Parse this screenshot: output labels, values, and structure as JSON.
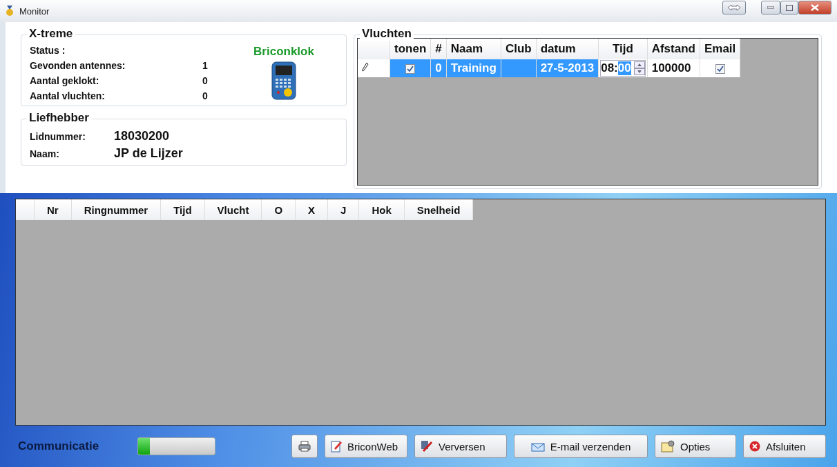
{
  "window": {
    "title": "Monitor"
  },
  "xtreme": {
    "title": "X-treme",
    "status_label": "Status :",
    "device_name": "Briconklok",
    "rows": [
      {
        "label": "Gevonden antennes:",
        "value": "1"
      },
      {
        "label": "Aantal geklokt:",
        "value": "0"
      },
      {
        "label": "Aantal vluchten:",
        "value": "0"
      }
    ]
  },
  "liefhebber": {
    "title": "Liefhebber",
    "rows": [
      {
        "label": "Lidnummer:",
        "value": "18030200"
      },
      {
        "label": "Naam:",
        "value": "JP de Lijzer"
      }
    ]
  },
  "vluchten": {
    "title": "Vluchten",
    "columns": [
      "tonen",
      "#",
      "Naam",
      "Club",
      "datum",
      "Tijd",
      "Afstand",
      "Email"
    ],
    "rows": [
      {
        "selected": true,
        "editing": true,
        "tonen": true,
        "number": "0",
        "naam": "Training",
        "datum": "27-5-2013",
        "time_hours": "08:",
        "time_minutes": "00",
        "minutes_selected": true,
        "afstand": "100000",
        "email": true
      }
    ]
  },
  "results": {
    "columns": [
      "Nr",
      "Ringnummer",
      "Tijd",
      "Vlucht",
      "O",
      "X",
      "J",
      "Hok",
      "Snelheid"
    ]
  },
  "footer": {
    "label": "Communicatie",
    "level": 0.15,
    "buttons": [
      {
        "kind": "print"
      },
      {
        "kind": "web",
        "label": "BriconWeb"
      },
      {
        "kind": "refresh",
        "label": "Verversen"
      },
      {
        "kind": "mail",
        "label": "E-mail verzenden"
      },
      {
        "kind": "options",
        "label": "Opties"
      },
      {
        "kind": "close",
        "label": "Afsluiten"
      }
    ]
  }
}
